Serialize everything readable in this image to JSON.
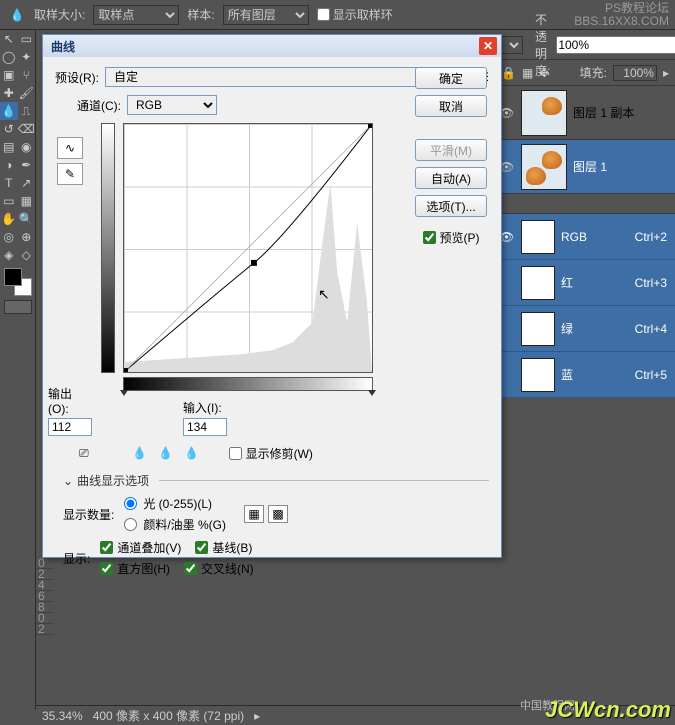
{
  "topbar": {
    "sample_size_label": "取样大小:",
    "sample_size_value": "取样点",
    "sample_label": "样本:",
    "sample_value": "所有图层",
    "show_ring": "显示取样环"
  },
  "watermark": {
    "l1": "PS教程论坛",
    "l2": "BBS.16XX8.COM"
  },
  "dialog": {
    "title": "曲线",
    "preset_label": "预设(R):",
    "preset_value": "自定",
    "channel_label": "通道(C):",
    "channel_value": "RGB",
    "output_label": "输出(O):",
    "output_value": "112",
    "input_label": "输入(I):",
    "input_value": "134",
    "show_clip": "显示修剪(W)",
    "expand": "曲线显示选项",
    "qty_label": "显示数量:",
    "qty_light": "光 (0-255)(L)",
    "qty_ink": "颜料/油墨 %(G)",
    "show_label": "显示:",
    "ch_overlay": "通道叠加(V)",
    "baseline": "基线(B)",
    "histogram": "直方图(H)",
    "cross": "交叉线(N)",
    "btn_ok": "确定",
    "btn_cancel": "取消",
    "btn_smooth": "平滑(M)",
    "btn_auto": "自动(A)",
    "btn_options": "选项(T)...",
    "preview": "预览(P)"
  },
  "layers": {
    "opacity_label": "不透明度:",
    "opacity_value": "100%",
    "fill_label": "填充:",
    "fill_value": "100%",
    "items": [
      {
        "name": "图层 1 副本",
        "sel": false
      },
      {
        "name": "图层 1",
        "sel": true
      }
    ]
  },
  "channels": [
    {
      "name": "RGB",
      "sc": "Ctrl+2"
    },
    {
      "name": "红",
      "sc": "Ctrl+3"
    },
    {
      "name": "绿",
      "sc": "Ctrl+4"
    },
    {
      "name": "蓝",
      "sc": "Ctrl+5"
    }
  ],
  "status": {
    "zoom": "35.34%",
    "doc": "400 像素 x 400 像素 (72 ppi)"
  },
  "footer": {
    "cn": "中国教程网",
    "jcw": "JCWcn.com"
  },
  "chart_data": {
    "type": "line",
    "title": "Curves",
    "xlabel": "输入",
    "ylabel": "输出",
    "xlim": [
      0,
      255
    ],
    "ylim": [
      0,
      255
    ],
    "series": [
      {
        "name": "RGB",
        "values": [
          [
            0,
            0
          ],
          [
            134,
            112
          ],
          [
            255,
            255
          ]
        ]
      }
    ]
  }
}
